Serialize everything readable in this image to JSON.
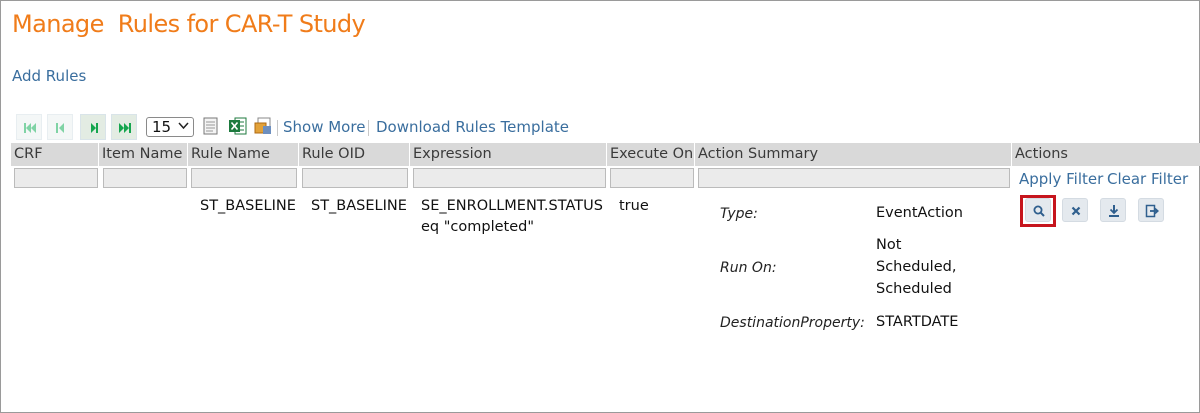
{
  "page": {
    "title": "Manage  Rules for CAR-T Study"
  },
  "add_rules_link": "Add Rules",
  "toolbar": {
    "page_size": "15",
    "show_more": "Show More",
    "download_template": "Download Rules Template"
  },
  "table": {
    "columns": [
      "CRF",
      "Item Name",
      "Rule Name",
      "Rule OID",
      "Expression",
      "Execute On",
      "Action Summary",
      "Actions"
    ],
    "filter_links": {
      "apply": "Apply Filter",
      "clear": "Clear Filter"
    },
    "rows": [
      {
        "crf": "",
        "item_name": "",
        "rule_name": "ST_BASELINE",
        "rule_oid": "ST_BASELINE",
        "expression_line1": "SE_ENROLLMENT.STATUS",
        "expression_line2": "eq \"completed\"",
        "execute_on": "true",
        "action_summary": {
          "type_label": "Type:",
          "type_value": "EventAction",
          "run_on_label": "Run On:",
          "run_on_line1": "Not",
          "run_on_line2": "Scheduled,",
          "run_on_line3": "Scheduled",
          "dest_label": "DestinationProperty:",
          "dest_value": "STARTDATE"
        }
      }
    ]
  },
  "colors": {
    "title": "#f07c1a",
    "link": "#3a6e9e",
    "highlight": "#c6151d",
    "header_bg": "#d9d9d9"
  },
  "icons": [
    "first-page-icon",
    "prev-page-icon",
    "next-page-icon",
    "last-page-icon",
    "print-icon",
    "excel-icon",
    "pdf-icon",
    "search-icon",
    "remove-icon",
    "download-icon",
    "export-icon"
  ]
}
